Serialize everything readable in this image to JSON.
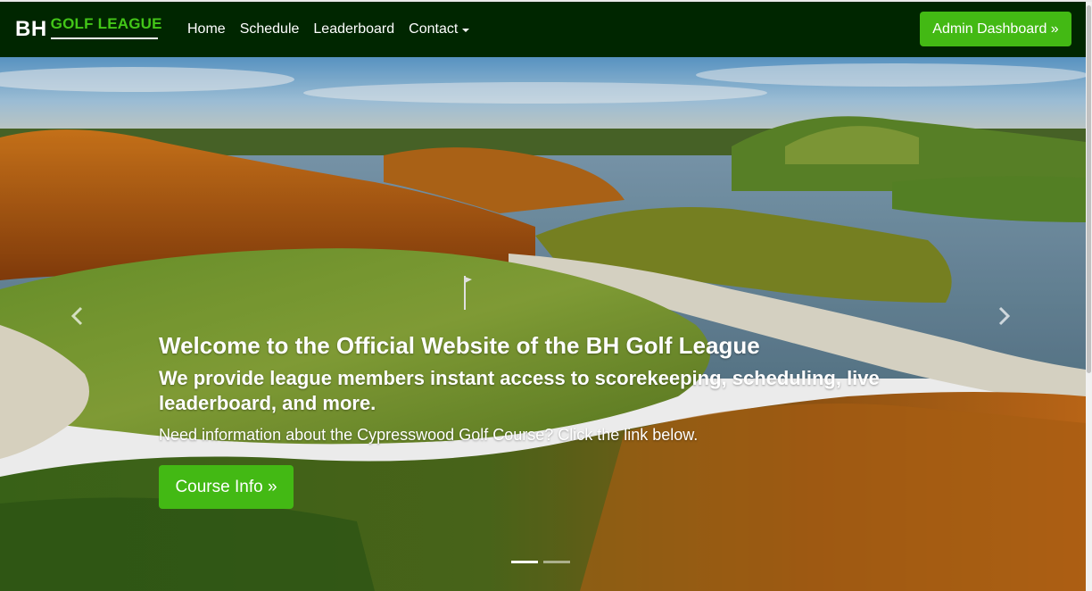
{
  "brand": {
    "prefix": "BH",
    "name": "GOLF LEAGUE"
  },
  "nav": {
    "links": [
      {
        "label": "Home"
      },
      {
        "label": "Schedule"
      },
      {
        "label": "Leaderboard"
      },
      {
        "label": "Contact"
      }
    ],
    "admin_button": "Admin Dashboard »"
  },
  "hero": {
    "title": "Welcome to the Official Website of the BH Golf League",
    "subtitle": "We provide league members instant access to scorekeeping, scheduling, live leaderboard, and more.",
    "text": "Need information about the Cypresswood Golf Course? Click the link below.",
    "button": "Course Info »",
    "slides": 2,
    "active_slide": 1
  },
  "colors": {
    "navbar": "#002600",
    "accent": "#43b914",
    "brand_green": "#43c618"
  },
  "icons": {
    "prev": "chevron-left-icon",
    "next": "chevron-right-icon",
    "dropdown": "caret-down-icon"
  }
}
